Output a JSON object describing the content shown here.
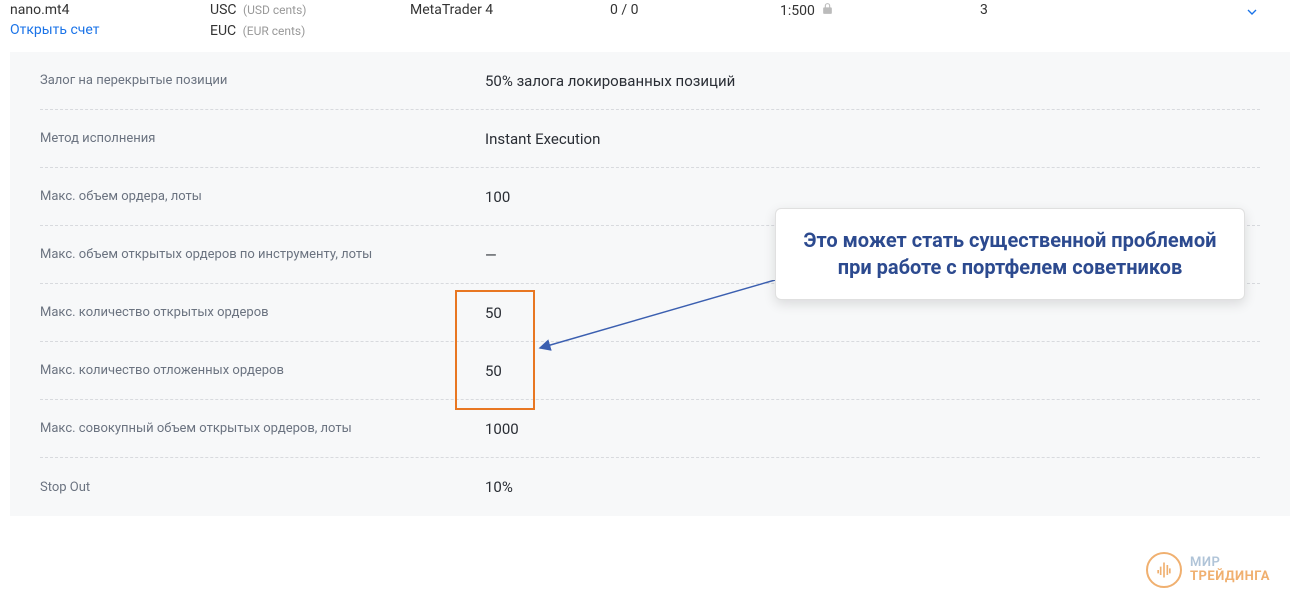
{
  "header": {
    "account_name": "nano.mt4",
    "open_account_link": "Открыть счет",
    "currencies": [
      {
        "code": "USC",
        "desc": "(USD cents)"
      },
      {
        "code": "EUC",
        "desc": "(EUR cents)"
      }
    ],
    "platform": "MetaTrader 4",
    "zeros": "0 / 0",
    "leverage": "1:500",
    "spread": "3"
  },
  "details": [
    {
      "label": "Залог на перекрытые позиции",
      "value": "50% залога локированных позиций"
    },
    {
      "label": "Метод исполнения",
      "value": "Instant Execution"
    },
    {
      "label": "Макс. объем ордера, лоты",
      "value": "100"
    },
    {
      "label": "Макс. объем открытых ордеров по инструменту, лоты",
      "value": "—"
    },
    {
      "label": "Макс. количество открытых ордеров",
      "value": "50"
    },
    {
      "label": "Макс. количество отложенных ордеров",
      "value": "50"
    },
    {
      "label": "Макс. совокупный объем открытых ордеров, лоты",
      "value": "1000"
    },
    {
      "label": "Stop Out",
      "value": "10%"
    }
  ],
  "callout": {
    "text": "Это может стать существенной проблемой при работе с портфелем советников"
  },
  "watermark": {
    "line1": "МИР",
    "line2": "ТРЕЙДИНГА"
  }
}
